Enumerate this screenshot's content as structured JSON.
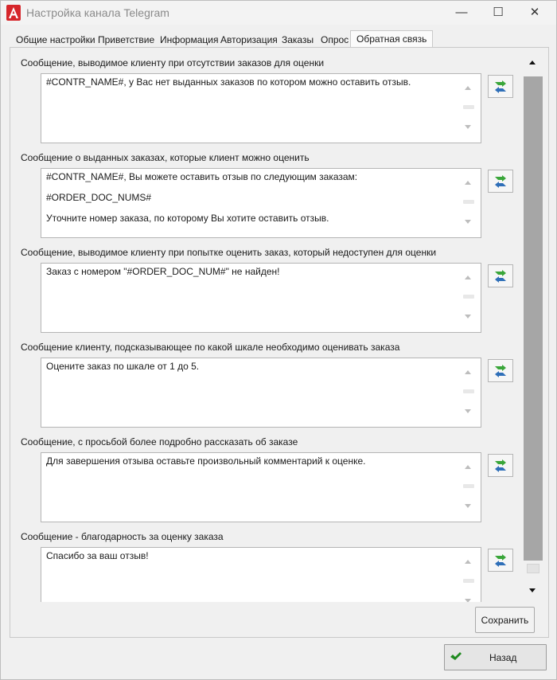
{
  "window": {
    "title": "Настройка канала Telegram",
    "controls": {
      "minimize": "—",
      "maximize": "☐",
      "close": "✕"
    }
  },
  "tabs": [
    {
      "label": "Общие настройки",
      "active": false
    },
    {
      "label": "Приветствие",
      "active": false
    },
    {
      "label": "Информация",
      "active": false
    },
    {
      "label": "Авторизация",
      "active": false
    },
    {
      "label": "Заказы",
      "active": false
    },
    {
      "label": "Опрос",
      "active": false
    },
    {
      "label": "Обратная связь",
      "active": true
    }
  ],
  "sections": [
    {
      "label": "Сообщение, выводимое клиенту при отсутствии заказов для оценки",
      "text": "#CONTR_NAME#, у Вас нет выданных заказов по котором можно оставить отзыв."
    },
    {
      "label": "Сообщение о выданных заказах, которые клиент можно оценить",
      "text": "#CONTR_NAME#, Вы можете оставить отзыв по следующим заказам:\n\n#ORDER_DOC_NUMS#\n\nУточните номер заказа, по которому Вы хотите оставить отзыв."
    },
    {
      "label": "Сообщение, выводимое клиенту при попытке оценить заказ, который недоступен для оценки",
      "text": "Заказ с номером \"#ORDER_DOC_NUM#\" не найден!"
    },
    {
      "label": "Сообщение клиенту, подсказывающее по какой шкале необходимо оценивать заказа",
      "text": "Оцените заказ по шкале от 1 до 5."
    },
    {
      "label": "Сообщение, с просьбой более подробно рассказать об заказе",
      "text": "Для завершения отзыва оставьте произвольный комментарий к оценке."
    },
    {
      "label": "Сообщение - благодарность за оценку заказа",
      "text": "Спасибо за ваш отзыв!"
    }
  ],
  "buttons": {
    "save": "Сохранить",
    "back": "Назад"
  },
  "icons": {
    "app": "app-logo-icon",
    "reset": "reset-default-icon",
    "back": "checkmark-icon"
  },
  "colors": {
    "accent_red": "#d6262b",
    "reset_green": "#3aa63a",
    "reset_blue": "#2f6fb8",
    "check_green": "#1f8a1f"
  }
}
